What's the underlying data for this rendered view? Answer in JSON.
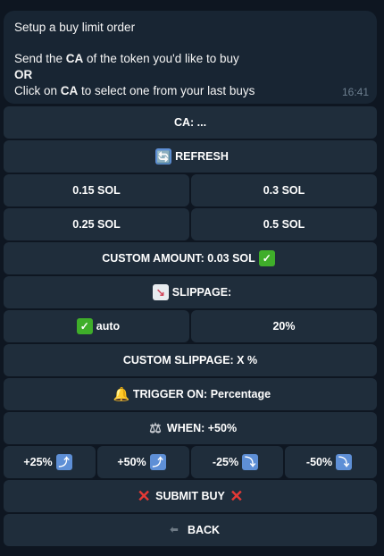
{
  "message": {
    "line1": "Setup a buy limit order",
    "line2_pre": "Send the ",
    "line2_bold": "CA",
    "line2_post": " of the token you'd like to buy",
    "line3": "OR",
    "line4_pre": "Click on ",
    "line4_bold": "CA",
    "line4_post": " to select one from your last buys",
    "time": "16:41"
  },
  "keyboard": {
    "ca": "CA: ...",
    "refresh": "REFRESH",
    "amount_015": "0.15 SOL",
    "amount_03": "0.3 SOL",
    "amount_025": "0.25 SOL",
    "amount_05": "0.5 SOL",
    "custom_amount": "CUSTOM AMOUNT: 0.03 SOL",
    "slippage": "SLIPPAGE:",
    "slippage_auto": "auto",
    "slippage_20": "20%",
    "custom_slippage": "CUSTOM SLIPPAGE: X %",
    "trigger_on": "TRIGGER ON: Percentage",
    "when": "WHEN: +50%",
    "plus25": "+25%",
    "plus50": "+50%",
    "minus25": "-25%",
    "minus50": "-50%",
    "submit": "SUBMIT BUY",
    "back": "BACK"
  },
  "icons": {
    "refresh": "refresh-icon",
    "check": "check-mark-icon",
    "chart": "chart-decreasing-icon",
    "bell": "bell-icon",
    "scale": "balance-scale-icon",
    "up": "arrow-up-icon",
    "down": "arrow-down-icon",
    "cross": "cross-mark-icon",
    "back": "back-arrow-icon"
  },
  "colors": {
    "background": "#0e1621",
    "message_bubble": "#182533",
    "button": "#1f2d3b",
    "check": "#3fae2a",
    "cross": "#e53935"
  }
}
